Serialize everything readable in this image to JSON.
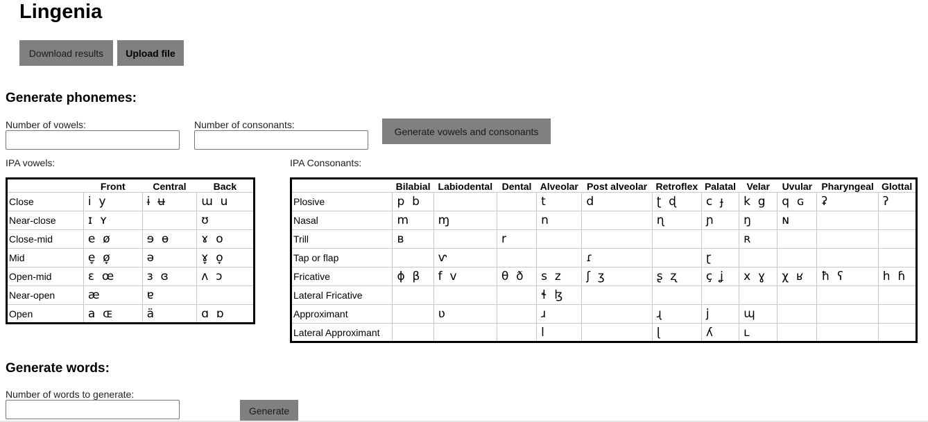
{
  "app": {
    "title": "Lingenia"
  },
  "toolbar": {
    "download_label": "Download results",
    "upload_label": "Upload file"
  },
  "phonemes": {
    "heading": "Generate phonemes:",
    "vowels_label": "Number of vowels:",
    "consonants_label": "Number of consonants:",
    "generate_label": "Generate vowels and consonants",
    "ipa_vowels_label": "IPA vowels:",
    "ipa_consonants_label": "IPA Consonants:"
  },
  "vowels": {
    "columns": [
      "Front",
      "Central",
      "Back"
    ],
    "rows": [
      {
        "label": "Close",
        "cells": [
          "i  y",
          "ɨ  ʉ",
          "ɯ  u"
        ]
      },
      {
        "label": "Near-close",
        "cells": [
          "ɪ  ʏ",
          "",
          "ʊ"
        ]
      },
      {
        "label": "Close-mid",
        "cells": [
          "e  ø",
          "ɘ  ɵ",
          "ɤ  o"
        ]
      },
      {
        "label": "Mid",
        "cells": [
          "e̞  ø̞",
          "ə",
          "ɤ̞  o̞"
        ]
      },
      {
        "label": "Open-mid",
        "cells": [
          "ɛ  œ",
          "ɜ  ɞ",
          "ʌ  ɔ"
        ]
      },
      {
        "label": "Near-open",
        "cells": [
          "æ",
          "ɐ",
          ""
        ]
      },
      {
        "label": "Open",
        "cells": [
          "a  ɶ",
          "ä",
          "ɑ  ɒ"
        ]
      }
    ]
  },
  "consonants": {
    "columns": [
      "Bilabial",
      "Labiodental",
      "Dental",
      "Alveolar",
      "Post alveolar",
      "Retroflex",
      "Palatal",
      "Velar",
      "Uvular",
      "Pharyngeal",
      "Glottal"
    ],
    "rows": [
      {
        "label": "Plosive",
        "cells": [
          "p  b",
          "",
          "",
          "t",
          "d",
          "ʈ  ɖ",
          "c  ɟ",
          "k  g",
          "q  ɢ",
          "ʡ",
          "ʔ"
        ]
      },
      {
        "label": "Nasal",
        "cells": [
          "m",
          "ɱ",
          "",
          "n",
          "",
          "ɳ",
          "ɲ",
          "ŋ",
          "ɴ",
          "",
          ""
        ]
      },
      {
        "label": "Trill",
        "cells": [
          "ʙ",
          "",
          "r",
          "",
          "",
          "",
          "",
          "ʀ",
          "",
          "",
          ""
        ]
      },
      {
        "label": "Tap or flap",
        "cells": [
          "",
          "ⱱ",
          "",
          "",
          "ɾ",
          "",
          "ɽ",
          "",
          "",
          "",
          ""
        ]
      },
      {
        "label": "Fricative",
        "cells": [
          "ɸ  β",
          "f  v",
          "θ  ð",
          "s  z",
          "ʃ  ʒ",
          "ʂ  ʐ",
          "ç  ʝ",
          "x  ɣ",
          "χ  ʁ",
          "ħ  ʕ",
          "h  ɦ"
        ]
      },
      {
        "label": "Lateral Fricative",
        "cells": [
          "",
          "",
          "",
          "ɬ  ɮ",
          "",
          "",
          "",
          "",
          "",
          "",
          ""
        ]
      },
      {
        "label": "Approximant",
        "cells": [
          "",
          "ʋ",
          "",
          "ɹ",
          "",
          "ɻ",
          "j",
          "ɰ",
          "",
          "",
          ""
        ]
      },
      {
        "label": "Lateral Approximant",
        "cells": [
          "",
          "",
          "",
          "l",
          "",
          "ɭ",
          "ʎ",
          "ʟ",
          "",
          "",
          ""
        ]
      }
    ]
  },
  "words": {
    "heading": "Generate words:",
    "count_label": "Number of words to generate:",
    "generate_label": "Generate"
  },
  "colors": {
    "button_bg": "#808080",
    "table_border": "#000000",
    "cell_border": "#c8c8c8"
  }
}
